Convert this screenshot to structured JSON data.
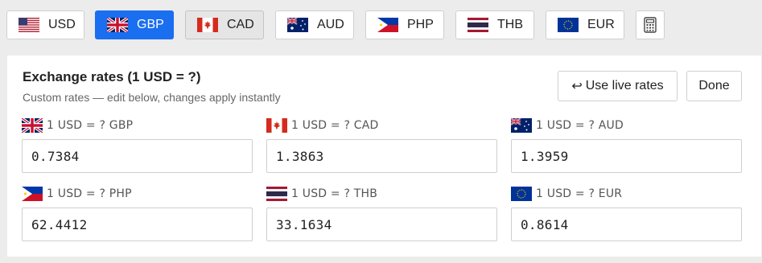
{
  "currency_tabs": [
    {
      "code": "USD",
      "flag": "us-flag-icon",
      "state": "default"
    },
    {
      "code": "GBP",
      "flag": "uk-flag-icon",
      "state": "active"
    },
    {
      "code": "CAD",
      "flag": "canada-flag-icon",
      "state": "pressed"
    },
    {
      "code": "AUD",
      "flag": "australia-flag-icon",
      "state": "default"
    },
    {
      "code": "PHP",
      "flag": "philippines-flag-icon",
      "state": "default"
    },
    {
      "code": "THB",
      "flag": "thailand-flag-icon",
      "state": "default"
    },
    {
      "code": "EUR",
      "flag": "eu-flag-icon",
      "state": "default"
    }
  ],
  "calculator_icon": "calculator-icon",
  "colors": {
    "accent": "#1a6ef0",
    "page_background": "#ececec",
    "panel_background": "#ffffff",
    "border": "#cfcfcf"
  },
  "panel": {
    "title": "Exchange rates (1 USD = ?)",
    "subtitle": "Custom rates — edit below, changes apply instantly",
    "use_live_rates_icon": "undo-arrow-icon",
    "use_live_rates_label": "Use live rates",
    "done_label": "Done"
  },
  "rates": [
    {
      "label": "1 USD = ? GBP",
      "value": "0.7384",
      "flag": "uk-flag-icon"
    },
    {
      "label": "1 USD = ? CAD",
      "value": "1.3863",
      "flag": "canada-flag-icon"
    },
    {
      "label": "1 USD = ? AUD",
      "value": "1.3959",
      "flag": "australia-flag-icon"
    },
    {
      "label": "1 USD = ? PHP",
      "value": "62.4412",
      "flag": "philippines-flag-icon"
    },
    {
      "label": "1 USD = ? THB",
      "value": "33.1634",
      "flag": "thailand-flag-icon"
    },
    {
      "label": "1 USD = ? EUR",
      "value": "0.8614",
      "flag": "eu-flag-icon"
    }
  ]
}
